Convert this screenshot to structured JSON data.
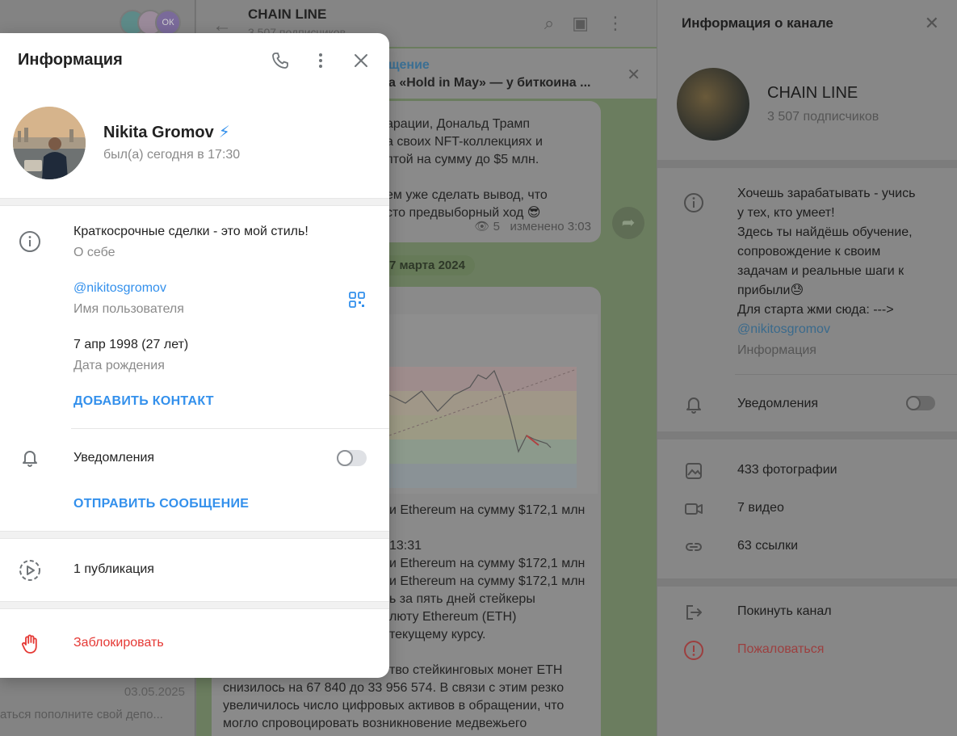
{
  "background": {
    "chat_list": {
      "date": "03.05.2025",
      "snippet": "аться пополните свой депо...",
      "avatar_badge": "ОК"
    },
    "chat_header": {
      "title": "CHAIN LINE",
      "subtitle": "3 507 подписчиков"
    },
    "pinned": {
      "title": "щение",
      "text": "а «Hold in May» — у биткоина ..."
    },
    "message_1": {
      "lines": [
        "арации, Дональд Трамп",
        "а своих NFT-коллекциях и",
        "птой на сумму до $5 млн.",
        "",
        "ем уже сделать вывод, что",
        "сто предвыборный ход 😎"
      ],
      "views": "5",
      "edited": "изменено 3:03"
    },
    "date_pill": "7 марта 2024",
    "message_2": {
      "lines": [
        "и Ethereum на сумму $172,1 млн",
        "",
        "13:31",
        "и Ethereum на сумму $172,1 млн",
        "и Ethereum на сумму $172,1 млн",
        "ь за пять дней стейкеры",
        "люту Ethereum (ETH)",
        "текущему курсу.",
        "",
        "тво стейкинговых монет ETH",
        "снизилось на 67 840 до 33 956 574. В связи с этим резко",
        "увеличилось число цифровых активов в обращении, что",
        "могло спровоцировать возникновение медвежьего"
      ]
    }
  },
  "channel_panel": {
    "header_title": "Информация о канале",
    "name": "CHAIN LINE",
    "subscribers": "3 507 подписчиков",
    "about_lines": [
      "Хочешь зарабатывать - учись",
      "у тех, кто умеет!",
      "Здесь ты найдёшь обучение,",
      "сопровождение к своим",
      "задачам и реальные шаги к",
      "прибыли😓",
      "Для старта жми сюда: --->"
    ],
    "about_link": "@nikitosgromov",
    "about_caption": "Информация",
    "notifications_label": "Уведомления",
    "notifications_on": false,
    "media": {
      "photos": "433 фотографии",
      "videos": "7 видео",
      "links": "63 ссылки"
    },
    "leave_label": "Покинуть канал",
    "report_label": "Пожаловаться"
  },
  "user_info": {
    "title": "Информация",
    "name": "Nikita Gromov",
    "premium_icon": "bolt-icon",
    "status": "был(а) сегодня в 17:30",
    "bio": "Краткосрочные сделки - это мой стиль!",
    "bio_caption": "О себе",
    "username": "@nikitosgromov",
    "username_caption": "Имя пользователя",
    "birthday": "7 апр 1998 (27 лет)",
    "birthday_caption": "Дата рождения",
    "add_contact": "ДОБАВИТЬ КОНТАКТ",
    "notifications_label": "Уведомления",
    "notifications_on": false,
    "send_message": "ОТПРАВИТЬ СООБЩЕНИЕ",
    "publications": "1 публикация",
    "block": "Заблокировать",
    "colors": {
      "accent": "#3390ec",
      "danger": "#e53935"
    }
  }
}
